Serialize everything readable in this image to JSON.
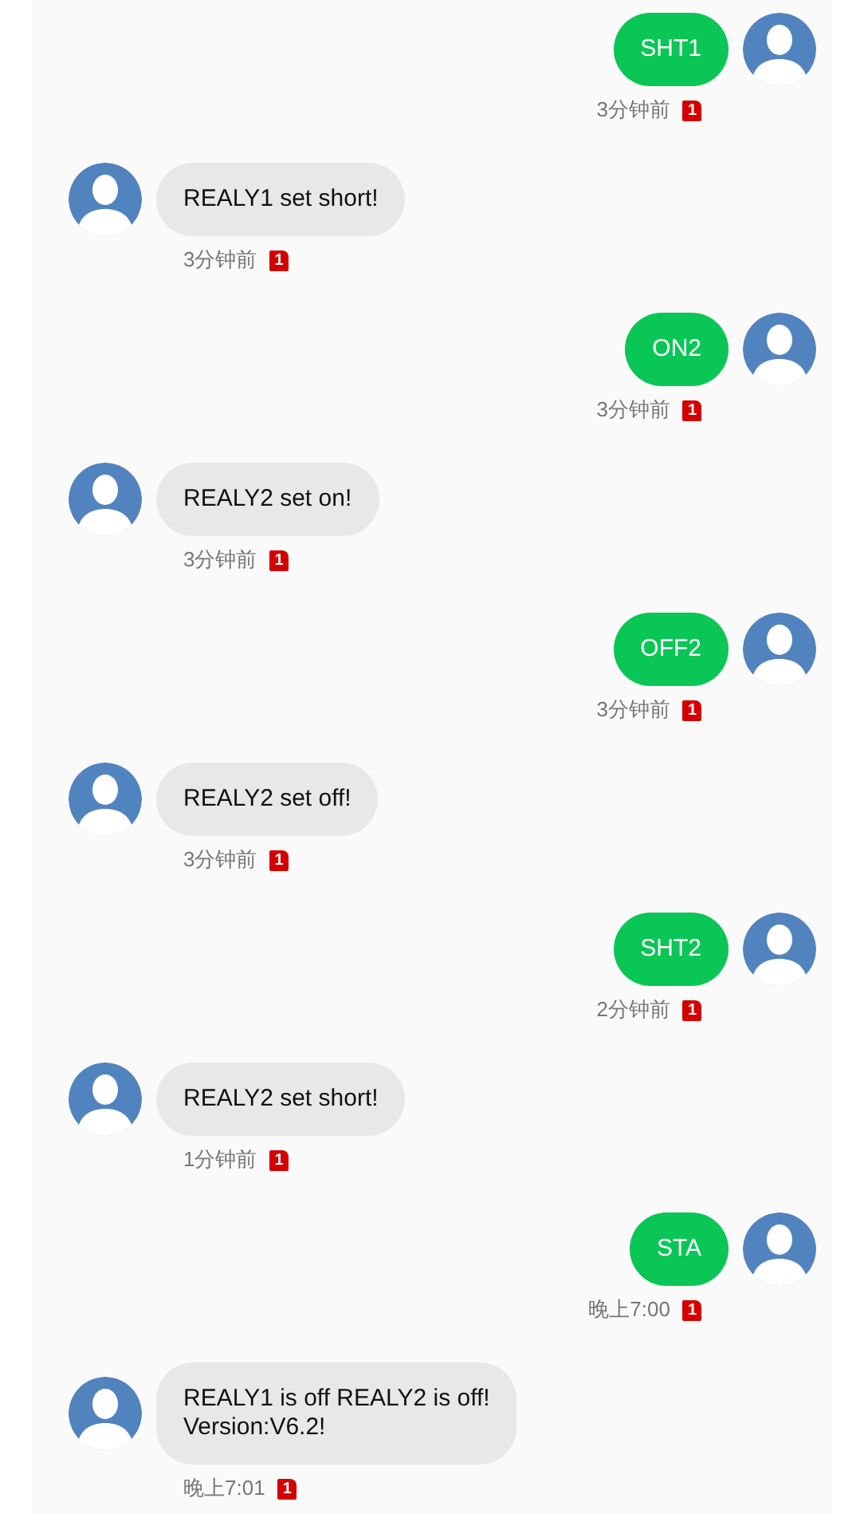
{
  "messages": [
    {
      "kind": "sent",
      "text": "SHT1",
      "time": "3分钟前",
      "sim": "1"
    },
    {
      "kind": "received",
      "text": "REALY1 set short!",
      "time": "3分钟前",
      "sim": "1"
    },
    {
      "kind": "sent",
      "text": "ON2",
      "time": "3分钟前",
      "sim": "1"
    },
    {
      "kind": "received",
      "text": "REALY2 set on!",
      "time": "3分钟前",
      "sim": "1"
    },
    {
      "kind": "sent",
      "text": "OFF2",
      "time": "3分钟前",
      "sim": "1"
    },
    {
      "kind": "received",
      "text": "REALY2 set off!",
      "time": "3分钟前",
      "sim": "1"
    },
    {
      "kind": "sent",
      "text": "SHT2",
      "time": "2分钟前",
      "sim": "1"
    },
    {
      "kind": "received",
      "text": "REALY2 set short!",
      "time": "1分钟前",
      "sim": "1"
    },
    {
      "kind": "sent",
      "text": "STA",
      "time": "晚上7:00",
      "sim": "1"
    },
    {
      "kind": "received",
      "text": "REALY1 is off REALY2 is off!\nVersion:V6.2!",
      "time": "晚上7:01",
      "sim": "1"
    }
  ]
}
